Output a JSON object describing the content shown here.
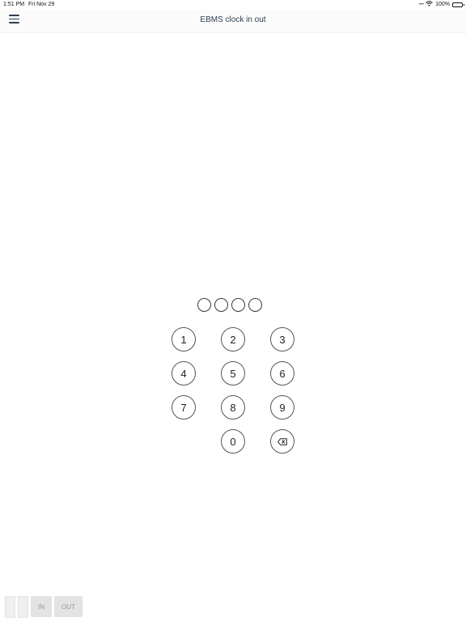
{
  "status_bar": {
    "time": "1:51 PM",
    "date": "Fri Nov 29",
    "battery": "100%",
    "icons": [
      "wifi-icon",
      "battery-icon"
    ]
  },
  "nav": {
    "title": "EBMS clock in out",
    "menu_icon": "hamburger-menu-icon"
  },
  "pin": {
    "length": 4
  },
  "keypad": {
    "keys": [
      "1",
      "2",
      "3",
      "4",
      "5",
      "6",
      "7",
      "8",
      "9",
      "0"
    ],
    "delete_icon": "backspace-icon"
  },
  "actions": {
    "in_label": "IN",
    "out_label": "OUT"
  }
}
